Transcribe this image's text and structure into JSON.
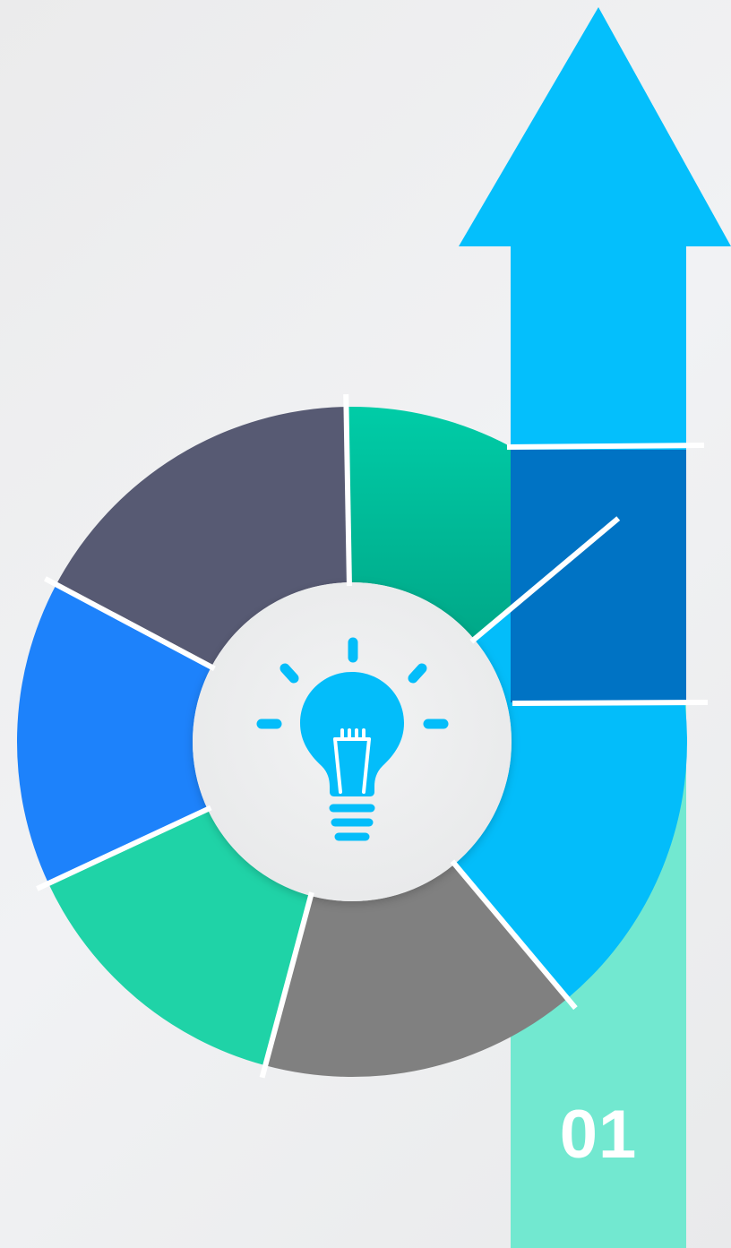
{
  "step": {
    "number": "01"
  },
  "center": {
    "icon": "lightbulb-icon"
  },
  "colors": {
    "arrow_light": "#04bffc",
    "arrow_dark": "#0073c4",
    "ring_teal": "#00c9a4",
    "ring_sky": "#03bdfa",
    "ring_gray": "#808080",
    "ring_green": "#1fd3a7",
    "ring_blue": "#1d82fb",
    "ring_slate": "#575a73",
    "base_bar": "#72e8d0",
    "bulb": "#03bdfa",
    "background": "#eeeff0"
  },
  "ring_segments": [
    {
      "name": "ring-segment-teal",
      "color_key": "ring_teal"
    },
    {
      "name": "ring-segment-sky",
      "color_key": "ring_sky"
    },
    {
      "name": "ring-segment-gray",
      "color_key": "ring_gray"
    },
    {
      "name": "ring-segment-green",
      "color_key": "ring_green"
    },
    {
      "name": "ring-segment-blue",
      "color_key": "ring_blue"
    },
    {
      "name": "ring-segment-slate",
      "color_key": "ring_slate"
    }
  ]
}
